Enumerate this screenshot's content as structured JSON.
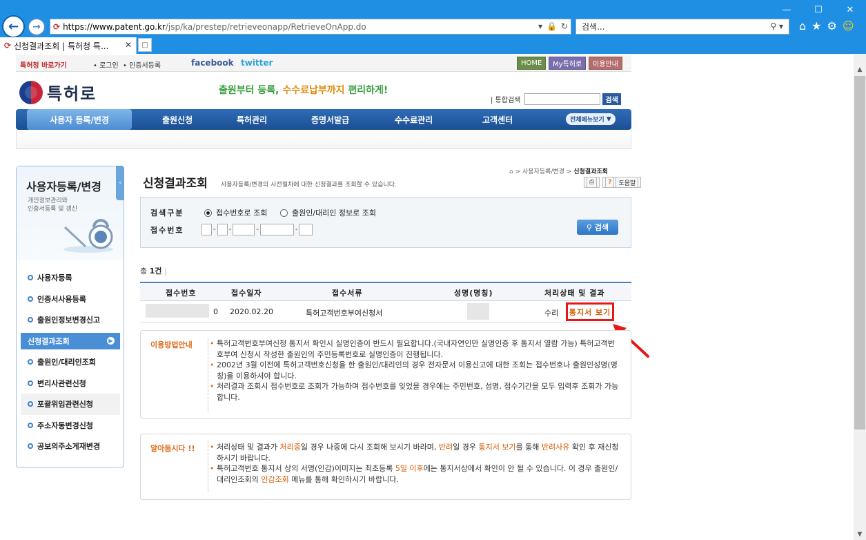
{
  "browser": {
    "url_host": "https://www.patent.go.kr",
    "url_path": "/jsp/ka/prestep/retrieveonapp/RetrieveOnApp.do",
    "search_placeholder": "검색...",
    "tab_title": "신청결과조회 | 특허청 특...",
    "window_controls": [
      "minimize",
      "maximize",
      "close"
    ]
  },
  "topbar": {
    "shortcut": "특허청 바로가기",
    "login": "로그인",
    "cert_register": "인증서등록",
    "facebook": "facebook",
    "twitter": "twitter",
    "home": "HOME",
    "my_patent": "My특허로",
    "guide": "이용안내"
  },
  "header": {
    "logo_text": "특허로",
    "slogan_pre": "출원부터 등록, ",
    "slogan_hl": "수수료납부까지",
    "slogan_post": " 편리하게!",
    "unified_search_label": "통합검색",
    "unified_search_button": "검색"
  },
  "gnb": {
    "items": [
      "사용자 등록/변경",
      "출원신청",
      "특허관리",
      "증명서발급",
      "수수료관리",
      "고객센터"
    ],
    "all_menu": "전체메뉴보기"
  },
  "lnb": {
    "title": "사용자등록/변경",
    "desc_line1": "개인정보관리와",
    "desc_line2": "인증서등록 및 갱신",
    "items": [
      "사용자등록",
      "인증서사용등록",
      "출원인정보변경신고",
      "신청결과조회",
      "출원인/대리인조회",
      "변리사관련신청",
      "포괄위임관련신청",
      "주소자동변경신청",
      "공보의주소게재변경"
    ],
    "active_index": 3
  },
  "content": {
    "breadcrumb_path": "사용자등록/변경",
    "breadcrumb_current": "신청결과조회",
    "title": "신청결과조회",
    "desc": "사용자등록/변경의 사전절차에 대한 신청결과를 조회할 수 있습니다.",
    "print": "⎙",
    "help": "도움말"
  },
  "search": {
    "type_label": "검색구분",
    "option1": "접수번호로 조회",
    "option2": "출원인/대리인 정보로 조회",
    "selected": "접수번호로 조회",
    "number_label": "접수번호",
    "button": "검색"
  },
  "results": {
    "total_label": "총",
    "total_count": "1건",
    "columns": [
      "접수번호",
      "접수일자",
      "접수서류",
      "성명(명칭)",
      "처리상태 및 결과"
    ],
    "rows": [
      {
        "number_suffix": "0",
        "date": "2020.02.20",
        "doc": "특허고객번호부여신청서",
        "status": "수리",
        "action": "통지서 보기"
      }
    ]
  },
  "usage_guide": {
    "title": "이용방법안내",
    "items": [
      "특허고객번호부여신청 통지서 확인시 실명인증이 반드시 필요합니다.(국내자연인만 실명인증 후 통지서 열람 가능) 특허고객번호부여 신청시 작성한 출원인의 주민등록번호로 실명인증이 진행됩니다.",
      "2002년 3월 이전에 특허고객번호신청을 한 출원인/대리인의 경우 전자문서 이용신고에 대한 조회는 접수번호나 출원인성명(명칭)을 이용하셔야 합니다.",
      "처리결과 조회시 접수번호로 조회가 가능하며 접수번호를 잊었을 경우에는 주민번호, 성명, 접수기간을 모두 입력후 조회가 가능합니다."
    ]
  },
  "notice": {
    "title": "알아둡시다 !!",
    "item1_a": "처리상태 및 결과가 ",
    "item1_h1": "처리중",
    "item1_b": "일 경우 나중에 다시 조회해 보시기 바라며, ",
    "item1_h2": "반려",
    "item1_c": "일 경우 ",
    "item1_h3": "통지서 보기",
    "item1_d": "를 통해 ",
    "item1_h4": "반려사유",
    "item1_e": " 확인 후 재신청 하시기 바랍니다.",
    "item2_a": "특허고객번호 통지서 상의 서명(인감)이미지는 최초등록 ",
    "item2_h1": "5일 이후",
    "item2_b": "에는 통지서상에서 확인이 안 될 수 있습니다. 이 경우 출원인/대리인조회의 ",
    "item2_h2": "인감조회",
    "item2_c": " 메뉴를 통해 확인하시기 바랍니다."
  },
  "colors": {
    "chrome": "#1f8fe4",
    "gnb": "#1c4f93",
    "accent_orange": "#e06a18",
    "highlight_red": "#e51818"
  }
}
